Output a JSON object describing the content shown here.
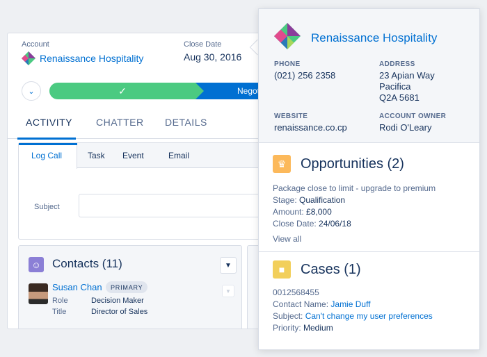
{
  "record": {
    "account_label": "Account",
    "account_name": "Renaissance Hospitality",
    "close_date_label": "Close Date",
    "close_date": "Aug 30, 2016",
    "path_current_stage": "Negoti",
    "path_complete_icon": "check-icon",
    "tabs": [
      {
        "label": "ACTIVITY"
      },
      {
        "label": "CHATTER"
      },
      {
        "label": "DETAILS"
      }
    ],
    "composer": {
      "tabs": [
        {
          "label": "Log Call"
        },
        {
          "label": "Task"
        },
        {
          "label": "Event"
        },
        {
          "label": "Email"
        }
      ],
      "subject_label": "Subject",
      "subject_value": ""
    },
    "contacts": {
      "title": "Contacts (11)",
      "contact": {
        "name": "Susan Chan",
        "badge": "PRIMARY",
        "role_label": "Role",
        "role": "Decision Maker",
        "title_label": "Title",
        "title": "Director of Sales"
      }
    }
  },
  "popover": {
    "account_name": "Renaissance Hospitality",
    "phone_label": "PHONE",
    "phone": "(021) 256 2358",
    "address_label": "ADDRESS",
    "address_lines": [
      "23 Apian Way",
      "Pacifica",
      "Q2A 5681"
    ],
    "website_label": "WEBSITE",
    "website": "renaissance.co.cp",
    "owner_label": "ACCOUNT OWNER",
    "owner": "Rodi O'Leary",
    "opportunities": {
      "title": "Opportunities (2)",
      "item_name": "Package close to limit - upgrade to premium",
      "stage_label": "Stage:",
      "stage": "Qualification",
      "amount_label": "Amount:",
      "amount": "£8,000",
      "close_label": "Close Date:",
      "close": "24/06/18",
      "view_all": "View all"
    },
    "cases": {
      "title": "Cases (1)",
      "number": "0012568455",
      "contact_label": "Contact Name:",
      "contact": "Jamie Duff",
      "subject_label": "Subject:",
      "subject": "Can't change my user preferences",
      "priority_label": "Priority:",
      "priority": "Medium"
    }
  },
  "colors": {
    "brand_blue": "#0070d2",
    "path_complete": "#4bca81",
    "opportunity_icon": "#fcb95b",
    "case_icon": "#f2cf5b",
    "contact_icon": "#8b7fd6"
  }
}
